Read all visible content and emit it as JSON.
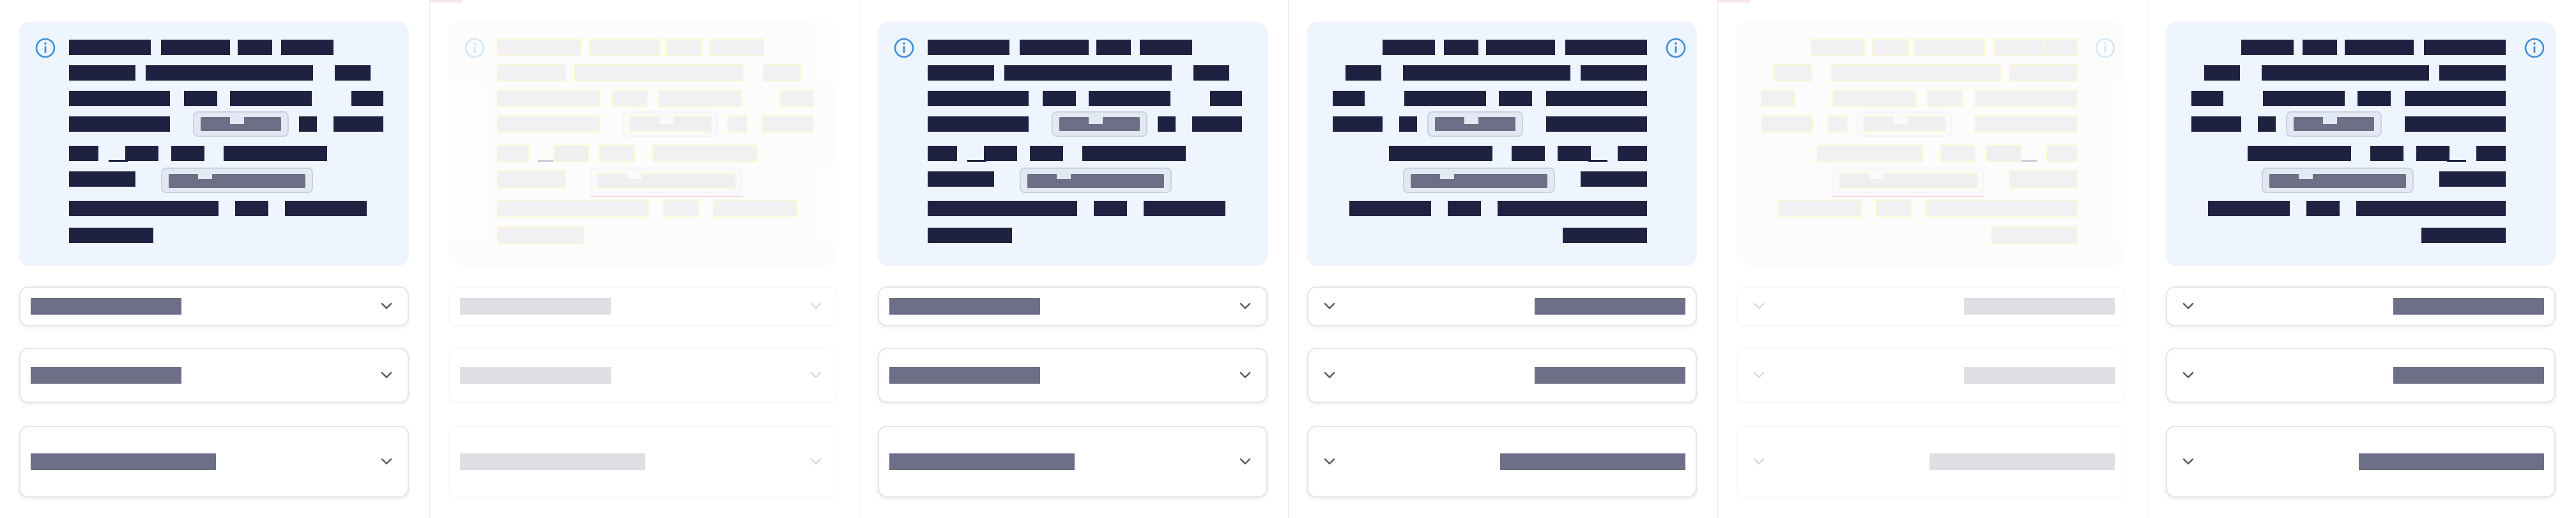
{
  "panels": [
    {
      "state": "active",
      "direction": "ltr",
      "accent": "#7b8bd6"
    },
    {
      "state": "faded",
      "direction": "ltr",
      "accent": "#e05050"
    },
    {
      "state": "active",
      "direction": "ltr",
      "accent": "#7b8bd6"
    },
    {
      "state": "active",
      "direction": "rtl",
      "accent": "#7b8bd6"
    },
    {
      "state": "faded",
      "direction": "rtl",
      "accent": "#e05050"
    },
    {
      "state": "active",
      "direction": "rtl",
      "accent": "#7b8bd6"
    }
  ],
  "icons": {
    "info": "info-icon",
    "chevron": "chevron-down-icon"
  },
  "colors": {
    "card_bg": "#eef5fe",
    "redacted_text": "#1f2140",
    "redacted_chip": "#6d6f86",
    "info_blue": "#3d8fd6",
    "border": "#e3e5ea"
  },
  "dropdowns_per_panel": 3
}
